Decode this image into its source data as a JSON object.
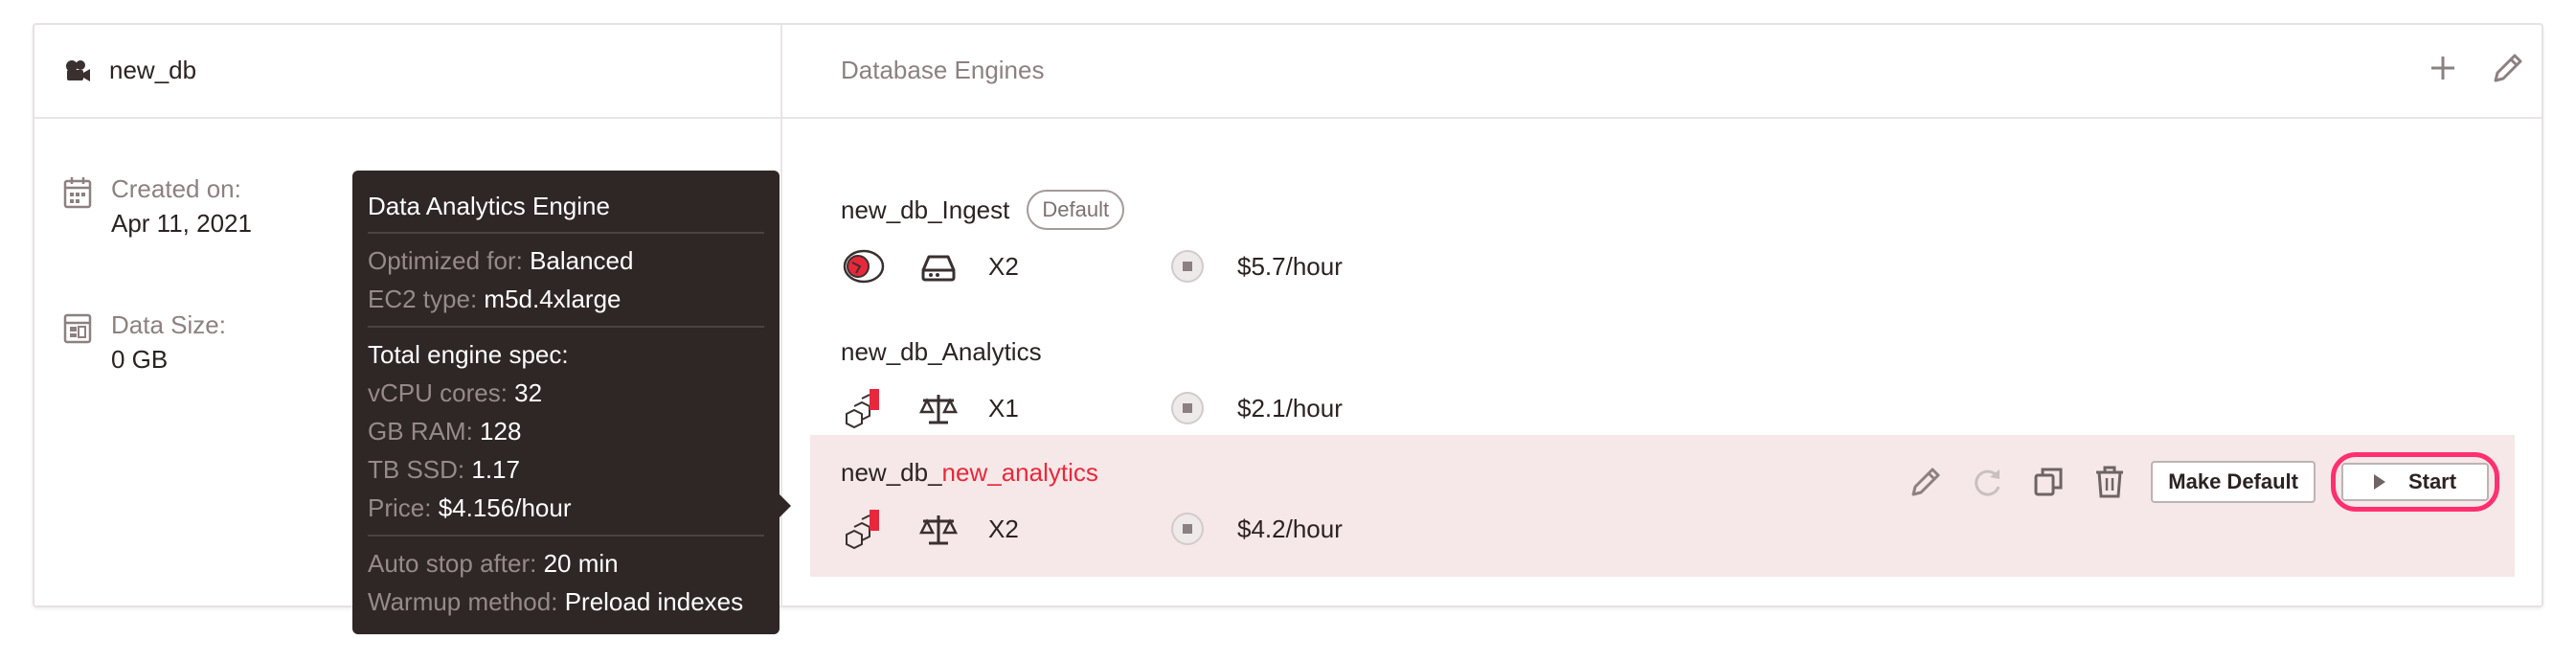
{
  "database": {
    "name": "new_db",
    "created_label": "Created on:",
    "created_value": "Apr 11, 2021",
    "size_label": "Data Size:",
    "size_value": "0 GB"
  },
  "engines_panel": {
    "title": "Database Engines",
    "add_icon": "plus-icon",
    "edit_icon": "pencil-icon"
  },
  "engines": [
    {
      "name": "new_db_Ingest",
      "badge": "Default",
      "type_icon": "ingest-icon",
      "spec_icon": "storage-drive-icon",
      "scale": "X2",
      "status_icon": "stopped-icon",
      "price": "$5.7/hour"
    },
    {
      "name": "new_db_Analytics",
      "type_icon": "analytics-cubes-icon",
      "spec_icon": "balance-scale-icon",
      "scale": "X1",
      "status_icon": "stopped-icon",
      "price": "$2.1/hour"
    },
    {
      "name_prefix": "new_db_",
      "name_highlight": "new_analytics",
      "type_icon": "analytics-cubes-icon",
      "spec_icon": "balance-scale-icon",
      "scale": "X2",
      "status_icon": "stopped-icon",
      "price": "$4.2/hour",
      "actions": {
        "make_default": "Make Default",
        "start": "Start"
      }
    }
  ],
  "tooltip": {
    "title": "Data Analytics Engine",
    "optimized_label": "Optimized for:",
    "optimized_value": "Balanced",
    "ec2_label": "EC2 type:",
    "ec2_value": "m5d.4xlarge",
    "spec_heading": "Total engine spec:",
    "vcpu_label": "vCPU cores:",
    "vcpu_value": "32",
    "ram_label": "GB RAM:",
    "ram_value": "128",
    "ssd_label": "TB SSD:",
    "ssd_value": "1.17",
    "price_label": "Price:",
    "price_value": "$4.156/hour",
    "autostop_label": "Auto stop after:",
    "autostop_value": "20 min",
    "warmup_label": "Warmup method:",
    "warmup_value": "Preload indexes"
  },
  "colors": {
    "accent": "#e8283a",
    "highlight_row": "#f6e8e8",
    "tooltip_bg": "#2f2626",
    "focus_ring": "#ff2f72"
  }
}
